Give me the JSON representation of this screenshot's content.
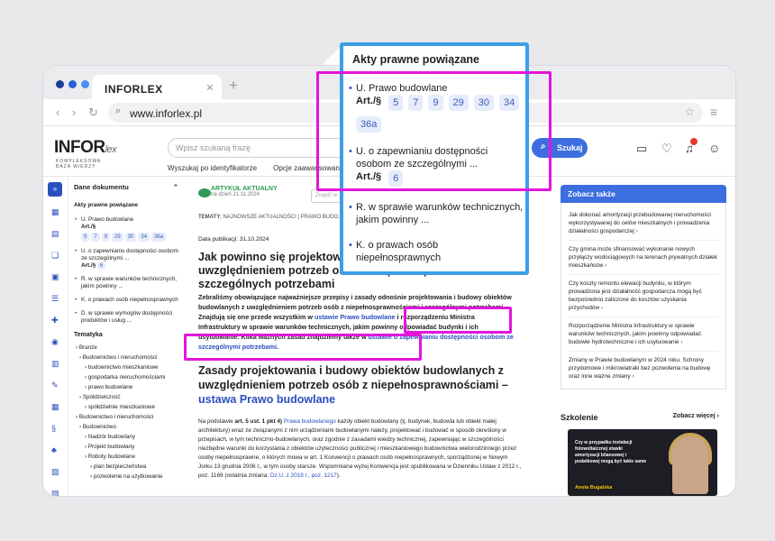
{
  "browser": {
    "tab_title": "INFORLEX",
    "url": "www.inforlex.pl"
  },
  "header": {
    "logo": "INFOR",
    "logo_suffix": "lex",
    "logo_sub": "KOMPLEKSOWA BAZA WIEDZY",
    "search_placeholder": "Wpisz szukaną frazę",
    "search_button": "Szukaj",
    "search_by_id": "Wyszukaj po identyfikatorze",
    "advanced": "Opcje zaawansowane",
    "notification_count": "1"
  },
  "left": {
    "section": "Dane dokumentu",
    "acts_title": "Akty prawne powiązane",
    "acts": [
      {
        "name": "U. Prawo budowlane",
        "label": "Art./§",
        "chips": [
          "5",
          "7",
          "9",
          "29",
          "30",
          "34",
          "36a"
        ]
      },
      {
        "name": "U. o zapewnianiu dostępności osobom ze szczególnymi ...",
        "label": "Art./§",
        "chips": [
          "6"
        ]
      },
      {
        "name": "R. w sprawie warunków technicznych, jakim powinny ...",
        "label": "",
        "chips": []
      },
      {
        "name": "K. o prawach osób niepełnosprawnych",
        "label": "",
        "chips": []
      },
      {
        "name": "D. w sprawie wymogów dostępności produktów i usług ...",
        "label": "",
        "chips": []
      }
    ],
    "topics_title": "Tematyka",
    "topics": [
      "Branże",
      "Budownictwo i nieruchomości",
      "budownictwo mieszkaniowe",
      "gospodarka nieruchomościami",
      "prawo budowlane",
      "Spółdzielczość",
      "spółdzielnie mieszkaniowe",
      "Budownictwo i nieruchomości",
      "Budownictwo",
      "Nadzór budowlany",
      "Projekt budowlany",
      "Roboty budowlane",
      "plan bezpieczeństwa",
      "pozwolenie na użytkowanie"
    ]
  },
  "article": {
    "status": "ARTYKUŁ AKTUALNY",
    "status_date": "na dzień 21.11.2024",
    "find": "Znajdź w",
    "tags_label": "TEMATY:",
    "tags": "NAJNOWSZE AKTUALNOŚCI  |  PRAWO BUDO...",
    "pub_date": "Data publikacji: 31.10.2024",
    "title": "Jak powinno się projektować i budować obiekty budowlane z uwzględnieniem potrzeb osób z niepełnosprawnościami i o szczególnych potrzebami",
    "lead_1": "Zebraliśmy obowiązujące najważniejsze przepisy i zasady odnośnie projektowania i budowy obiektów budowlanych z uwzględnieniem potrzeb osób z niepełnosprawnościami i szczególnymi potrzebami. Znajdują się one przede wszystkim w ",
    "lead_link1": "ustawie Prawo budowlane",
    "lead_2": " i rozporządzeniu Ministra Infrastruktury w sprawie warunków technicznych, jakim powinny odpowiadać budynki i ich usytuowanie. Kilka ważnych zasad znajdziemy także w ",
    "lead_link2": "ustawie o zapewnianiu dostępności osobom ze szczególnymi potrzebami",
    "lead_3": ".",
    "h2": "Zasady projektowania i budowy obiektów budowlanych z uwzględnieniem potrzeb osób z niepełnosprawnościami – ",
    "h2_link": "ustawa Prawo budowlane",
    "body_1": "Na podstawie ",
    "body_bold": "art. 5 ust. 1 pkt 4)",
    "body_link": "Prawa budowlanego",
    "body_2": " każdy obiekt budowlany (tj. budynek, budowla lub obiekt małej architektury) wraz ze związanymi z nim urządzeniami budowlanymi należy, projektować i budować w sposób określony w przepisach, w tym techniczno-budowlanych, oraz zgodnie z zasadami wiedzy technicznej, zapewniając w szczególności niezbędne warunki do korzystania z obiektów użyteczności publicznej i mieszkaniowego budownictwa wielorodzinnego przez osoby niepełnosprawne, o których mowa w art. 1 Konwencji o prawach osób niepełnosprawnych, sporządzonej w Nowym Jorku 13 grudnia 2006 r., w tym osoby starsze. Wspomniana wyżej Konwencja jest opublikowana w Dzienniku Ustaw z 2012 r., poz. 1169 (ostatnia zmiana: ",
    "body_link2": "Dz.U. z 2018 r., poz. 1217",
    "body_3": ")."
  },
  "right": {
    "see_also": "Zobacz także",
    "items": [
      "Jak dokonać amortyzacji przebudowanej nieruchomości wykorzystywanej do celów mieszkalnych i prowadzenia działalności gospodarczej",
      "Czy gmina może sfinansować wykonanie nowych przyłączy wodociągowych na terenach prywatnych działek mieszkańców",
      "Czy koszty remontu elewacji budynku, w którym prowadzona jest działalność gospodarcza mogą być bezpośrednio zaliczone do kosztów uzyskania przychodów",
      "Rozporządzenie Ministra Infrastruktury w sprawie warunków technicznych, jakim powinny odpowiadać budowle hydrotechniczne i ich usytuowanie",
      "Zmiany w Prawie budowlanym w 2024 roku. Schrony przydomowe i mikrowiatraki bez pozwolenia na budowę oraz inne ważne zmiany"
    ],
    "training": "Szkolenie",
    "more": "Zobacz więcej",
    "training_text": "Czy w przypadku instalacji fotowoltaicznej stawki amortyzacji bilansowej i podatkowej mogą być takie same",
    "trainer": "Aneta Bugalska"
  },
  "popup": {
    "title": "Akty prawne powiązane"
  }
}
